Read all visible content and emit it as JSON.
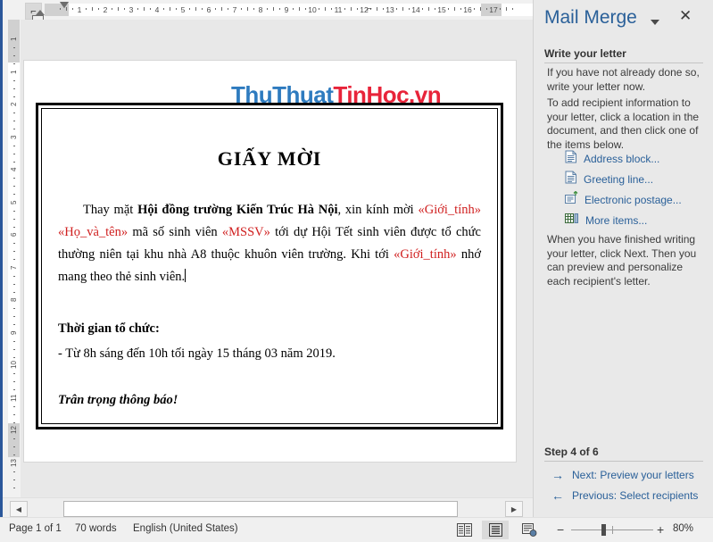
{
  "ruler": {
    "tab_stop_icon": "left-tab-icon",
    "h_labels": [
      "1",
      "2",
      "3",
      "4",
      "5",
      "6",
      "7",
      "8",
      "9",
      "10",
      "11",
      "12",
      "13",
      "14",
      "15",
      "16",
      "17"
    ],
    "v_labels": [
      "1",
      "1",
      "2",
      "3",
      "4",
      "5",
      "6",
      "7",
      "8",
      "9",
      "10",
      "11",
      "12",
      "13"
    ]
  },
  "document": {
    "watermark": {
      "part1": "ThuThuat",
      "part2": "TinHoc.vn",
      "color1": "#2e7bbf",
      "color2": "#e8243a"
    },
    "title": "GIẤY MỜI",
    "paragraph1": {
      "t1": "Thay mặt ",
      "b1": "Hội đồng trường Kiến Trúc Hà Nội",
      "t2": ", xin kính mời ",
      "f1": "«Giới_tính»",
      "t3": " ",
      "f2": "«Họ_và_tên»",
      "t4": " mã số sinh viên ",
      "f3": "«MSSV»",
      "t5": " tới dự Hội Tết sinh viên được tổ chức thường niên tại khu nhà A8 thuộc khuôn viên trường. Khi tới ",
      "f4": "«Giới_tính»",
      "t6": " nhớ mang theo thẻ sinh viên."
    },
    "heading_time": "Thời gian tổ chức:",
    "time_line": "- Từ 8h sáng đến 10h tối ngày 15 tháng 03 năm 2019.",
    "closing": "Trân trọng thông báo!"
  },
  "scrollbar": {
    "left_arrow": "◀",
    "right_arrow": "▶"
  },
  "status": {
    "pages": "Page 1 of 1",
    "words": "70 words",
    "language": "English (United States)",
    "zoom_minus": "−",
    "zoom_plus": "+",
    "zoom_percent": "80%",
    "views": [
      {
        "name": "read-mode-icon",
        "active": false
      },
      {
        "name": "print-layout-icon",
        "active": true
      },
      {
        "name": "web-layout-icon",
        "active": false
      }
    ]
  },
  "pane": {
    "title": "Mail Merge",
    "close_label": "✕",
    "heading": "Write your letter",
    "paragraph1": "If you have not already done so, write your letter now.",
    "paragraph2": "To add recipient information to your letter, click a location in the document, and then click one of the items below.",
    "items": [
      {
        "label": "Address block...",
        "icon": "document-lines-icon"
      },
      {
        "label": "Greeting line...",
        "icon": "document-lines-icon"
      },
      {
        "label": "Electronic postage...",
        "icon": "postage-stamp-icon"
      },
      {
        "label": "More items...",
        "icon": "table-fields-icon"
      }
    ],
    "paragraph3": "When you have finished writing your letter, click Next. Then you can preview and personalize each recipient's letter.",
    "step": "Step 4 of 6",
    "next_label": "Next: Preview your letters",
    "prev_label": "Previous: Select recipients",
    "next_arrow": "→",
    "prev_arrow": "←",
    "link_color": "#2a6099"
  }
}
